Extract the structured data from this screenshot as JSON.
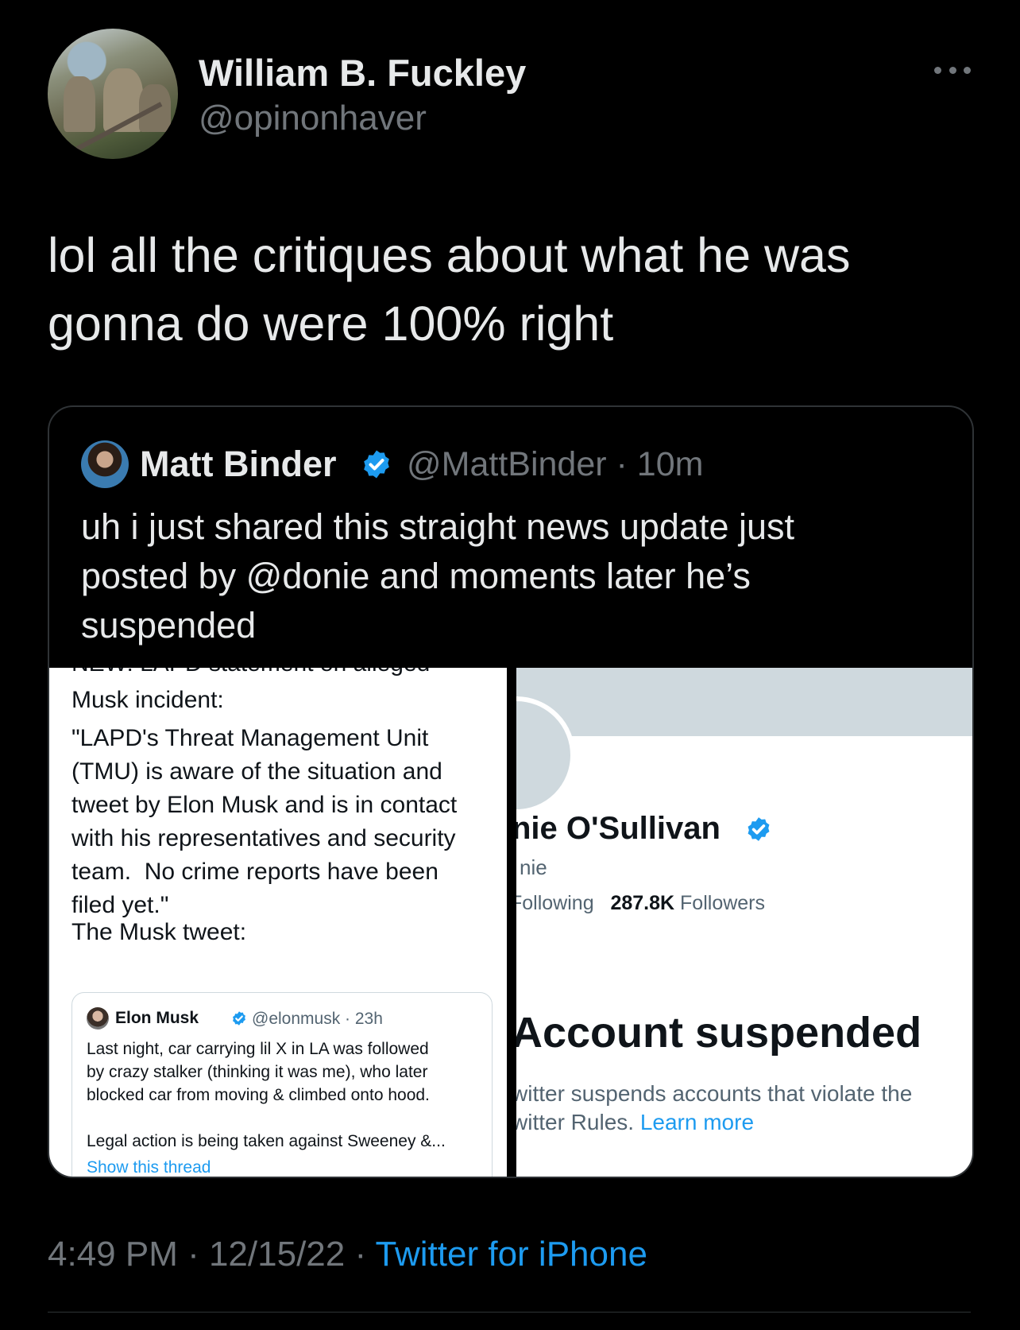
{
  "author": {
    "name": "William B. Fuckley",
    "handle": "@opinonhaver"
  },
  "tweet": {
    "text": "lol all the critiques about what he was\ngonna do were 100% right"
  },
  "quote": {
    "name": "Matt Binder",
    "handle_time": "@MattBinder · 10m",
    "text": "uh i just shared this straight news update just\nposted by @donie and moments later he’s\nsuspended",
    "left_image": {
      "cut_line": "NEW: LAPD statement on alleged",
      "intro": "Musk incident:",
      "statement": "\"LAPD's Threat Management Unit\n(TMU) is aware of the situation and\ntweet by Elon Musk and is in contact\nwith his representatives and security\nteam.  No crime reports have been\nfiled yet.\"",
      "musk_label": "The Musk tweet:",
      "embed": {
        "name": "Elon Musk",
        "handle_time": "@elonmusk · 23h",
        "text": "Last night, car carrying lil X in LA was followed\nby crazy stalker (thinking it was me), who later\nblocked car from moving & climbed onto hood.\n\nLegal action is being taken against Sweeney &...",
        "link": "Show this thread"
      }
    },
    "right_image": {
      "name": "nie O'Sullivan",
      "handle": "nie",
      "following_label": "Following",
      "followers_count": "287.8K",
      "followers_label": "Followers",
      "suspended_title": "Account suspended",
      "suspended_text": "witter suspends accounts that violate the\nwitter Rules. ",
      "learn_more": "Learn more"
    }
  },
  "footer": {
    "time_date": "4:49 PM · 12/15/22 · ",
    "source": "Twitter for iPhone"
  },
  "colors": {
    "background": "#000000",
    "text": "#e7e9ea",
    "muted": "#71767b",
    "accent": "#1d9bf0"
  }
}
